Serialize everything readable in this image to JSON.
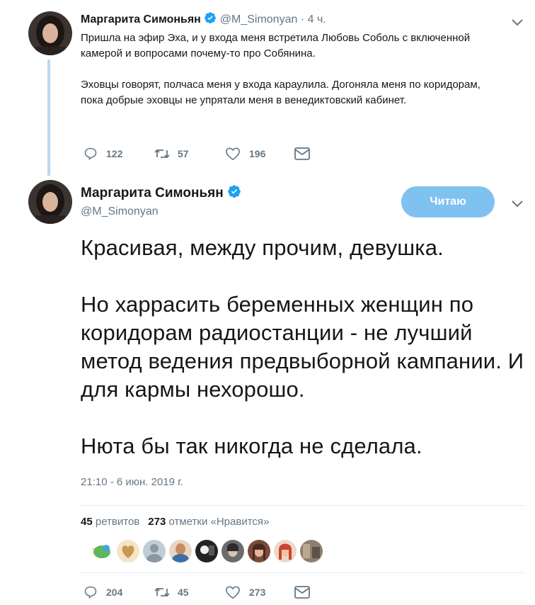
{
  "reply_tweet": {
    "author_name": "Маргарита Симоньян",
    "handle": "@M_Simonyan",
    "separator": "·",
    "time_ago": "4 ч.",
    "text_p1": "Пришла на эфир Эха, и у входа меня встретила Любовь Соболь с включенной камерой и вопросами почему-то про Собянина.",
    "text_p2": "Эховцы говорят, полчаса меня у входа караулила. Догоняла меня по коридорам, пока добрые эховцы не упрятали меня в венедиктовский кабинет.",
    "replies": "122",
    "retweets": "57",
    "likes": "196"
  },
  "main_tweet": {
    "author_name": "Маргарита Симоньян",
    "handle": "@M_Simonyan",
    "follow_label": "Читаю",
    "text_p1": "Красивая, между прочим, девушка.",
    "text_p2": "Но харрасить беременных женщин по коридорам радиостанции - не лучший метод ведения предвыборной кампании. И для кармы нехорошо.",
    "text_p3": "Нюта бы так никогда не сделала.",
    "timestamp": "21:10 - 6 июн. 2019 г.",
    "retweets_count": "45",
    "retweets_label": "ретвитов",
    "likes_count": "273",
    "likes_label": "отметки «Нравится»",
    "replies": "204",
    "retweets": "45",
    "likes": "273"
  },
  "colors": {
    "accent": "#1da1f2",
    "follow_button": "#7fc2f0",
    "thread_line": "#bcd9f0",
    "muted": "#657786"
  }
}
